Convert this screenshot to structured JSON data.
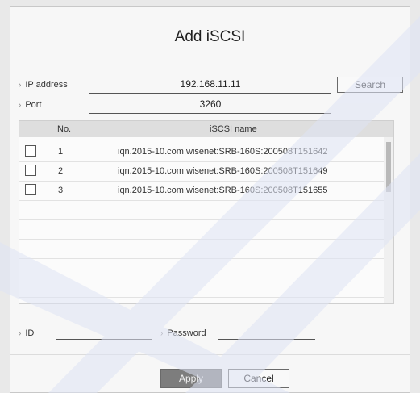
{
  "dialog": {
    "title": "Add iSCSI",
    "ip_label": "IP address",
    "ip_value": "192.168.11.11",
    "search_label": "Search",
    "port_label": "Port",
    "port_value": "3260",
    "table": {
      "col_no": "No.",
      "col_name": "iSCSI name",
      "rows": [
        {
          "no": "1",
          "name": "iqn.2015-10.com.wisenet:SRB-160S:200508T151642",
          "checked": false
        },
        {
          "no": "2",
          "name": "iqn.2015-10.com.wisenet:SRB-160S:200508T151649",
          "checked": false
        },
        {
          "no": "3",
          "name": "iqn.2015-10.com.wisenet:SRB-160S:200508T151655",
          "checked": false
        }
      ]
    },
    "id_label": "ID",
    "id_value": "",
    "password_label": "Password",
    "password_value": "",
    "apply_label": "Apply",
    "cancel_label": "Cancel"
  },
  "colors": {
    "apply_bg": "#7d7d7d",
    "watermark": "#dfe4f5"
  }
}
